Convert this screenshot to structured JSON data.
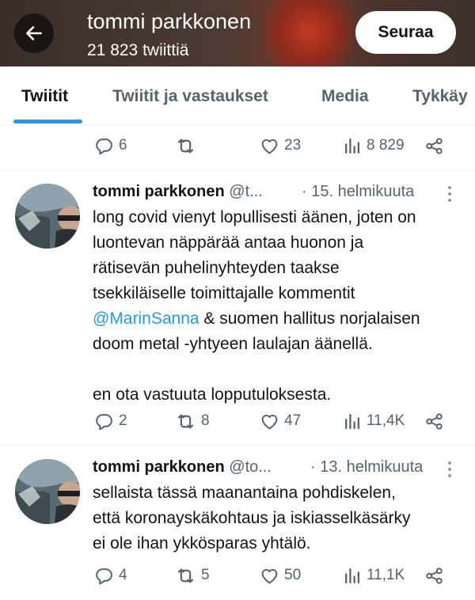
{
  "header": {
    "name": "tommi parkkonen",
    "tweet_count": "21 823 twiittiä",
    "follow_label": "Seuraa"
  },
  "tabs": [
    {
      "label": "Twiitit",
      "active": true
    },
    {
      "label": "Twiitit ja vastaukset",
      "active": false
    },
    {
      "label": "Media",
      "active": false
    },
    {
      "label": "Tykkäy",
      "active": false
    }
  ],
  "colors": {
    "accent": "#1d9bf0",
    "muted": "#536471",
    "text": "#0f1419"
  },
  "top_actions": {
    "replies": "6",
    "likes": "23",
    "views": "8 829"
  },
  "tweets": [
    {
      "name": "tommi parkkonen",
      "handle": "@t...",
      "date": "· 15. helmikuuta",
      "lines": [
        "long covid vienyt lopullisesti äänen, joten on",
        "luontevan näppärää antaa huonon ja",
        "rätisevän puhelinyhteyden taakse",
        "tsekkiläiselle toimittajalle kommentit"
      ],
      "mention": "@MarinSanna",
      "after_mention": " & suomen hallitus norjalaisen",
      "line6": "doom metal -yhtyeen laulajan äänellä.",
      "line8": "en ota vastuuta lopputuloksesta.",
      "replies": "2",
      "retweets": "8",
      "likes": "47",
      "views": "11,4K"
    },
    {
      "name": "tommi parkkonen",
      "handle": "@to...",
      "date": "· 13. helmikuuta",
      "lines": [
        "sellaista tässä maanantaina pohdiskelen,",
        "että koronayskäkohtaus ja iskiasselkäsärky",
        "ei ole ihan ykkösparas yhtälö."
      ],
      "replies": "4",
      "retweets": "5",
      "likes": "50",
      "views": "11,1K"
    }
  ],
  "icons": [
    "back-arrow-icon",
    "reply-icon",
    "retweet-icon",
    "like-icon",
    "views-icon",
    "share-icon",
    "more-icon"
  ]
}
